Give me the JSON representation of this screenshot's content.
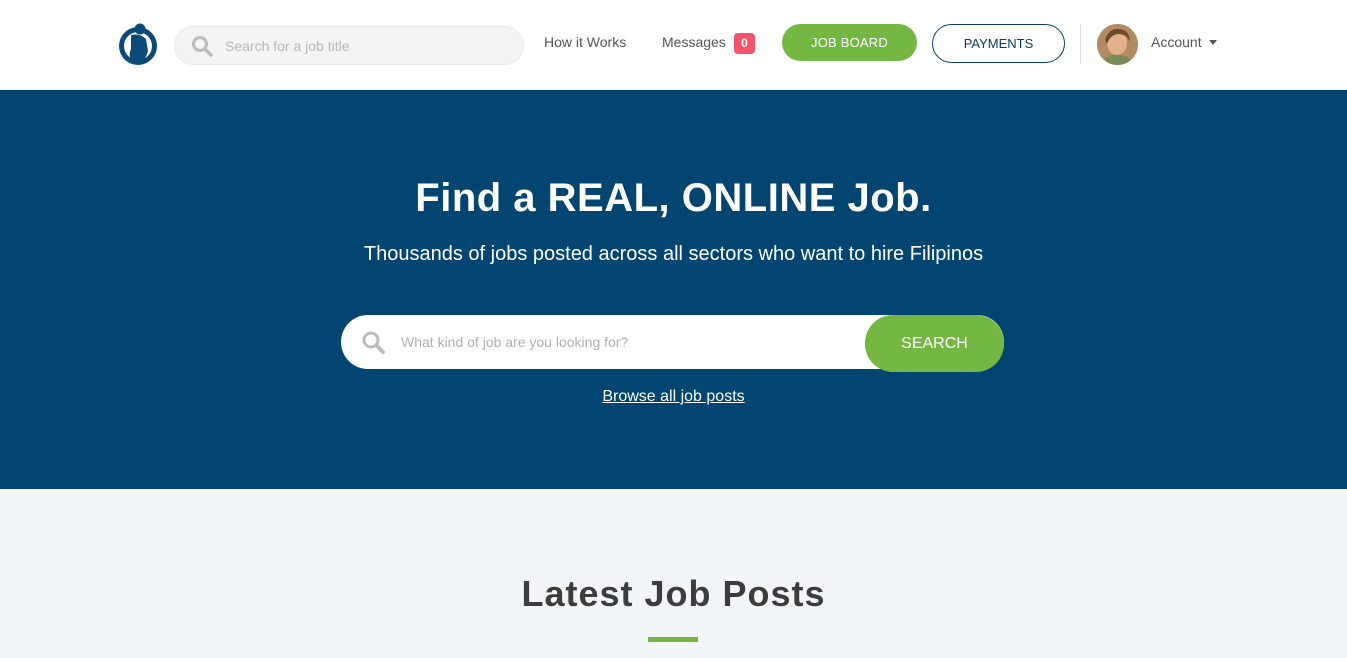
{
  "header": {
    "search_placeholder": "Search for a job title",
    "nav_how": "How it Works",
    "nav_messages": "Messages",
    "messages_count": "0",
    "btn_jobboard": "JOB BOARD",
    "btn_payments": "PAYMENTS",
    "account_label": "Account"
  },
  "hero": {
    "title": "Find a REAL, ONLINE Job.",
    "subtitle": "Thousands of jobs posted across all sectors who want to hire Filipinos",
    "search_placeholder": "What kind of job are you looking for?",
    "search_button": "SEARCH",
    "browse_link": "Browse all job posts"
  },
  "latest": {
    "title": "Latest Job Posts"
  },
  "colors": {
    "brand_blue": "#024570",
    "accent_green": "#74b843",
    "badge_red": "#f2546b"
  },
  "icons": [
    "logo-icon",
    "search-icon",
    "avatar-image",
    "caret-down-icon"
  ]
}
